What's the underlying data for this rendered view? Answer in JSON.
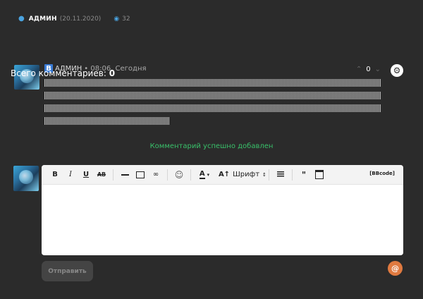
{
  "post_meta": {
    "author": "АДМИН",
    "date": "(20.11.2020)",
    "views": "32",
    "user_icon": "user-icon",
    "views_icon": "eye-icon"
  },
  "comments_total": {
    "label": "Всего комментариев:",
    "count": "0"
  },
  "comment": {
    "badge": "В",
    "author": "АДМИН",
    "time": "• 08:06, Сегодня",
    "vote_count": "0",
    "up_icon": "chevron-up-icon",
    "down_icon": "chevron-down-icon",
    "settings_icon": "gear-icon"
  },
  "status": {
    "success_message": "Комментарий успешно добавлен",
    "color": "#39c06a"
  },
  "editor": {
    "toolbar": {
      "bold": "B",
      "italic": "I",
      "underline": "U",
      "strike": "AB",
      "smile": "☺",
      "color": "A",
      "size": "A↑",
      "font": "Шрифт",
      "quote": "\"",
      "bbcode": "[BBcode]"
    },
    "text_value": ""
  },
  "submit_label": "Отправить",
  "mention_label": "@",
  "colors": {
    "background": "#2b2b2b",
    "accent": "#4aa3df",
    "badge": "#3a7bd5",
    "mention": "#e07a40"
  }
}
